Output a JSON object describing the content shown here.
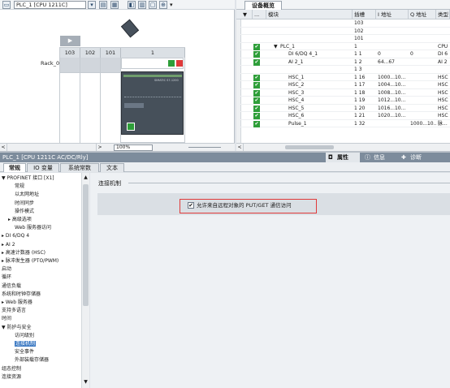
{
  "device_view": {
    "device_select": "PLC_1 [CPU 1211C]",
    "rack_label": "Rack_0",
    "slots": [
      "103",
      "102",
      "101",
      "1"
    ],
    "zoom": "100%",
    "plc_model": "SIMATIC S7-1200"
  },
  "overview": {
    "tab_label": "设备概览",
    "columns": [
      "模块",
      "插槽",
      "I 地址",
      "Q 地址",
      "类型"
    ],
    "rows": [
      {
        "module": "",
        "slot": "103",
        "i": "",
        "q": "",
        "type": "",
        "ok": false
      },
      {
        "module": "",
        "slot": "102",
        "i": "",
        "q": "",
        "type": "",
        "ok": false
      },
      {
        "module": "",
        "slot": "101",
        "i": "",
        "q": "",
        "type": "",
        "ok": false
      },
      {
        "module": "PLC_1",
        "slot": "1",
        "i": "",
        "q": "",
        "type": "CPU",
        "ok": true,
        "expand": "▼"
      },
      {
        "module": "DI 6/DQ 4_1",
        "slot": "1 1",
        "i": "0",
        "q": "0",
        "type": "DI 6",
        "ok": true
      },
      {
        "module": "AI 2_1",
        "slot": "1 2",
        "i": "64...67",
        "q": "",
        "type": "AI 2",
        "ok": true
      },
      {
        "module": "",
        "slot": "1 3",
        "i": "",
        "q": "",
        "type": "",
        "ok": false
      },
      {
        "module": "HSC_1",
        "slot": "1 16",
        "i": "1000...10...",
        "q": "",
        "type": "HSC",
        "ok": true
      },
      {
        "module": "HSC_2",
        "slot": "1 17",
        "i": "1004...10...",
        "q": "",
        "type": "HSC",
        "ok": true
      },
      {
        "module": "HSC_3",
        "slot": "1 18",
        "i": "1008...10...",
        "q": "",
        "type": "HSC",
        "ok": true
      },
      {
        "module": "HSC_4",
        "slot": "1 19",
        "i": "1012...10...",
        "q": "",
        "type": "HSC",
        "ok": true
      },
      {
        "module": "HSC_5",
        "slot": "1 20",
        "i": "1016...10...",
        "q": "",
        "type": "HSC",
        "ok": true
      },
      {
        "module": "HSC_6",
        "slot": "1 21",
        "i": "1020...10...",
        "q": "",
        "type": "HSC",
        "ok": true
      },
      {
        "module": "Pulse_1",
        "slot": "1 32",
        "i": "",
        "q": "1000...10...",
        "type": "脉...",
        "ok": true
      }
    ]
  },
  "properties": {
    "title": "PLC_1 [CPU 1211C AC/DC/Rly]",
    "side_tabs": [
      "属性",
      "信息",
      "诊断"
    ],
    "tabs": [
      "常规",
      "IO 变量",
      "系统常数",
      "文本"
    ],
    "nav": [
      {
        "label": "▼ PROFINET 接口 [X1]",
        "indent": 0
      },
      {
        "label": "常规",
        "indent": 2
      },
      {
        "label": "以太网地址",
        "indent": 2
      },
      {
        "label": "时间同步",
        "indent": 2
      },
      {
        "label": "操作模式",
        "indent": 2
      },
      {
        "label": "▸ 高级选项",
        "indent": 1
      },
      {
        "label": "Web 服务器访问",
        "indent": 2
      },
      {
        "label": "▸ DI 6/DQ 4",
        "indent": 0
      },
      {
        "label": "▸ AI 2",
        "indent": 0
      },
      {
        "label": "▸ 高速计数器 (HSC)",
        "indent": 0
      },
      {
        "label": "▸ 脉冲发生器 (PTO/PWM)",
        "indent": 0
      },
      {
        "label": "启动",
        "indent": 0
      },
      {
        "label": "循环",
        "indent": 0
      },
      {
        "label": "通信负载",
        "indent": 0
      },
      {
        "label": "系统和时钟存储器",
        "indent": 0
      },
      {
        "label": "▸ Web 服务器",
        "indent": 0
      },
      {
        "label": "支持多语言",
        "indent": 0
      },
      {
        "label": "时间",
        "indent": 0
      },
      {
        "label": "▼ 防护与安全",
        "indent": 0
      },
      {
        "label": "访问级别",
        "indent": 2
      },
      {
        "label": "连接机制",
        "indent": 2,
        "selected": true
      },
      {
        "label": "安全事件",
        "indent": 2
      },
      {
        "label": "外部装载存储器",
        "indent": 2
      },
      {
        "label": "组态控制",
        "indent": 0
      },
      {
        "label": "连接资源",
        "indent": 0
      }
    ],
    "section_title": "连接机制",
    "checkbox_label": "允许来自远程对象的 PUT/GET 通信访问",
    "checkbox_checked": "✔"
  },
  "colors": {
    "highlight": "#e03a3a",
    "ok_green": "#2e9e39",
    "title_bar": "#7d8c9c",
    "nav_selected": "#3a78c2"
  }
}
